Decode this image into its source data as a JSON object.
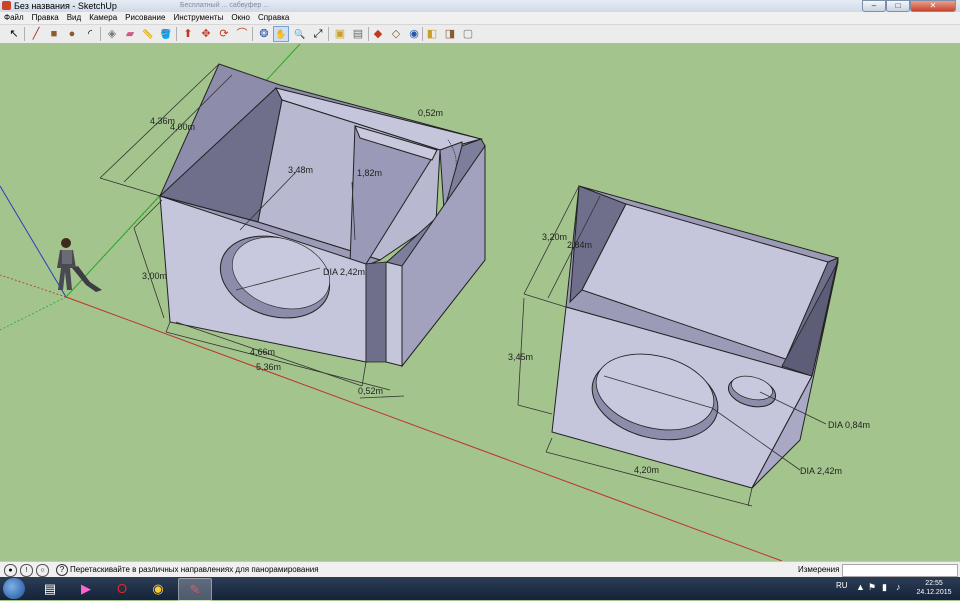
{
  "window": {
    "title": "Без названия - SketchUp",
    "background_tabs": "Бесплатный ... сабвуфер ...",
    "controls": {
      "minimize": "–",
      "maximize": "□",
      "close": "✕"
    }
  },
  "menu": [
    "Файл",
    "Правка",
    "Вид",
    "Камера",
    "Рисование",
    "Инструменты",
    "Окно",
    "Справка"
  ],
  "toolbar": {
    "tools": [
      {
        "name": "select-tool",
        "glyph": "↖"
      },
      {
        "name": "line-tool",
        "glyph": "╱"
      },
      {
        "name": "rectangle-tool",
        "glyph": "■"
      },
      {
        "name": "circle-tool",
        "glyph": "●"
      },
      {
        "name": "arc-tool",
        "glyph": "◜"
      },
      {
        "name": "make-component-tool",
        "glyph": "◈"
      },
      {
        "name": "eraser-tool",
        "glyph": "▰"
      },
      {
        "name": "tape-measure-tool",
        "glyph": "📏"
      },
      {
        "name": "paint-bucket-tool",
        "glyph": "🪣"
      },
      {
        "name": "push-pull-tool",
        "glyph": "⬆"
      },
      {
        "name": "move-tool",
        "glyph": "✥"
      },
      {
        "name": "rotate-tool",
        "glyph": "⟳"
      },
      {
        "name": "offset-tool",
        "glyph": "⌒"
      },
      {
        "name": "orbit-tool",
        "glyph": "❂"
      },
      {
        "name": "pan-tool",
        "glyph": "✋"
      },
      {
        "name": "zoom-tool",
        "glyph": "🔍"
      },
      {
        "name": "zoom-extents-tool",
        "glyph": "⤢"
      },
      {
        "name": "get-models-tool",
        "glyph": "▣"
      },
      {
        "name": "share-model-tool",
        "glyph": "▤"
      },
      {
        "name": "component-window-tool",
        "glyph": "◆"
      },
      {
        "name": "extension-warehouse-tool",
        "glyph": "◇"
      },
      {
        "name": "layout-tool",
        "glyph": "◉"
      },
      {
        "name": "warehouse-tool",
        "glyph": "◧"
      },
      {
        "name": "styles-tool",
        "glyph": "◨"
      },
      {
        "name": "scenes-tool",
        "glyph": "▢"
      }
    ]
  },
  "dimensions": {
    "box1": {
      "depth_outer": "4,36m",
      "depth_inner": "4,00m",
      "port_width": "0,52m",
      "inner_depth": "3,48m",
      "port_depth": "1,82m",
      "height": "3,00m",
      "speaker_dia": "DIA 2,42m",
      "width_inner": "4,66m",
      "width_outer": "5,36m",
      "port_gap": "0,52m"
    },
    "box2": {
      "depth_outer": "3,20m",
      "depth_inner": "2,84m",
      "height": "3,45m",
      "width": "4,20m",
      "port_dia": "DIA 0,84m",
      "speaker_dia": "DIA 2,42m"
    }
  },
  "status": {
    "text": "Перетаскивайте в различных направлениях для панорамирования",
    "measure_label": "Измерения",
    "measure_value": ""
  },
  "taskbar": {
    "language": "RU",
    "time": "22:55",
    "date": "24.12.2015"
  },
  "colors": {
    "ground": "#a3c58d",
    "box_face_light": "#c5c5dc",
    "box_face_mid": "#a9a9c6",
    "box_face_dark": "#6f6f8c",
    "axis_red": "#c0302a",
    "axis_green": "#2ea62e",
    "axis_blue": "#2a3ec0"
  }
}
